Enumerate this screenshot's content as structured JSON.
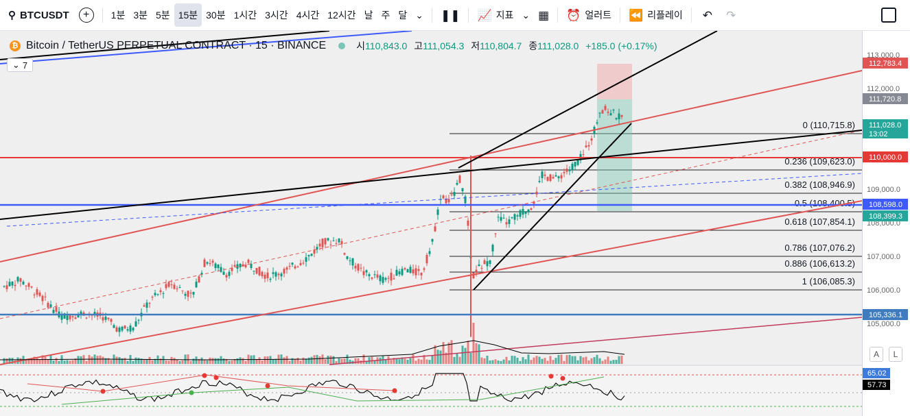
{
  "toolbar": {
    "symbol": "BTCUSDT",
    "intervals": [
      "1분",
      "3분",
      "5분",
      "15분",
      "30분",
      "1시간",
      "3시간",
      "4시간",
      "12시간",
      "날",
      "주",
      "달"
    ],
    "active_interval": "15분",
    "indicators_label": "지표",
    "alert_label": "얼러트",
    "replay_label": "리플레이"
  },
  "legend": {
    "title": "Bitcoin / TetherUS PERPETUAL CONTRACT · 15 · BINANCE",
    "open_label": "시",
    "open": "110,843.0",
    "high_label": "고",
    "high": "111,054.3",
    "low_label": "저",
    "low": "110,804.7",
    "close_label": "종",
    "close": "111,028.0",
    "change": "+185.0 (+0.17%)",
    "collapsed_count": "7"
  },
  "price_axis": {
    "ticks": [
      "113,000.0",
      "112,000.0",
      "111,000.0",
      "110,000.0",
      "109,000.0",
      "108,000.0",
      "107,000.0",
      "106,000.0",
      "105,000.0"
    ],
    "labels": [
      {
        "text": "112,783.4",
        "color": "#e05454"
      },
      {
        "text": "111,720.8",
        "color": "#868993"
      },
      {
        "text": "111,028.0",
        "sub": "13:02",
        "color": "#26a69a"
      },
      {
        "text": "110,000.0",
        "color": "#e53935"
      },
      {
        "text": "108,598.0",
        "color": "#3d5afe"
      },
      {
        "text": "108,399.3",
        "color": "#26a69a"
      },
      {
        "text": "105,336.1",
        "color": "#3f7bbf"
      }
    ]
  },
  "fib_levels": [
    {
      "label": "0 (110,715.8)"
    },
    {
      "label": "0.236 (109,623.0)"
    },
    {
      "label": "0.382 (108,946.9)"
    },
    {
      "label": "0.5 (108,400.5)"
    },
    {
      "label": "0.618 (107,854.1)"
    },
    {
      "label": "0.786 (107,076.2)"
    },
    {
      "label": "0.886 (106,613.2)"
    },
    {
      "label": "1 (106,085.3)"
    }
  ],
  "oscillator": {
    "level_upper": "65.02",
    "value": "57.73"
  },
  "scale_buttons": {
    "auto": "A",
    "log": "L"
  },
  "colors": {
    "up": "#089981",
    "down": "#e05454",
    "accent_red": "#e53935",
    "accent_blue": "#3d5afe"
  }
}
